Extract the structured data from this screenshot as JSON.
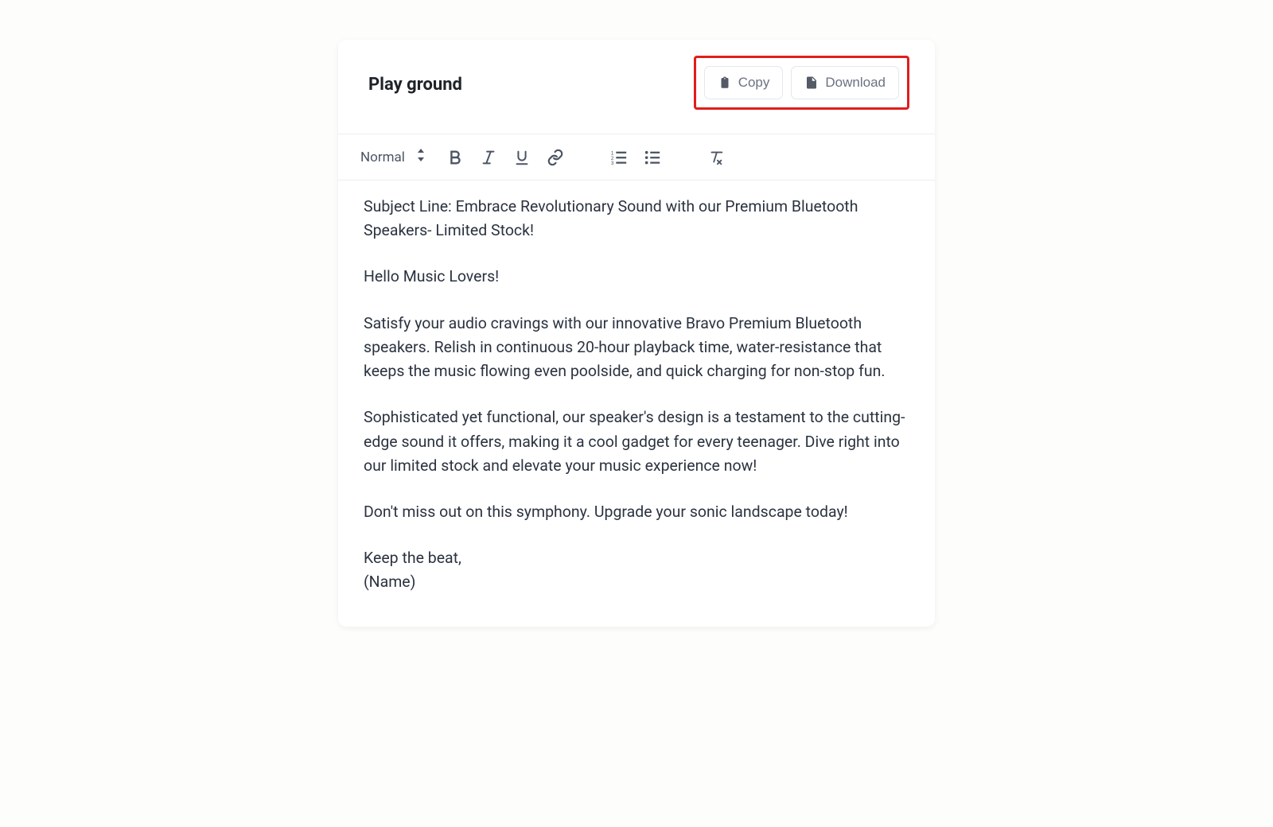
{
  "header": {
    "title": "Play ground",
    "copy_label": "Copy",
    "download_label": "Download"
  },
  "toolbar": {
    "format_label": "Normal"
  },
  "editor": {
    "lines": [
      "Subject Line: Embrace Revolutionary Sound with our Premium Bluetooth Speakers- Limited Stock!",
      "",
      "Hello Music Lovers!",
      "",
      "Satisfy your audio cravings with our innovative Bravo Premium Bluetooth speakers. Relish in continuous 20-hour playback time, water-resistance that keeps the music flowing even poolside, and quick charging for non-stop fun.",
      "",
      "Sophisticated yet functional, our speaker's design is a testament to the cutting-edge sound it offers, making it a cool gadget for every teenager. Dive right into our limited stock and elevate your music experience now!",
      "",
      "Don't miss out on this symphony. Upgrade your sonic landscape today!",
      "",
      "Keep the beat,",
      "(Name)"
    ]
  }
}
